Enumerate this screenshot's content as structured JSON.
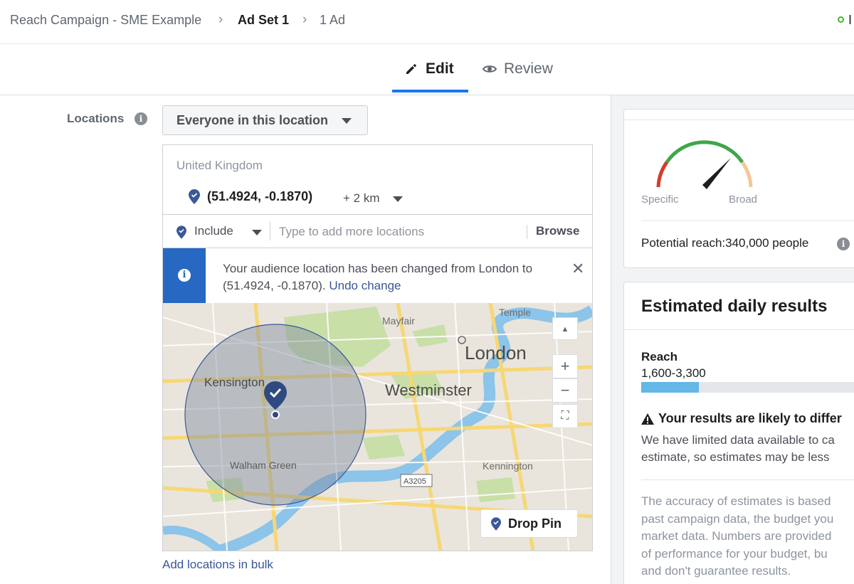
{
  "breadcrumb": {
    "campaign": "Reach Campaign - SME Example",
    "ad_set": "Ad Set 1",
    "ad": "1 Ad",
    "status_initial": "I"
  },
  "tabs": {
    "edit": "Edit",
    "review": "Review"
  },
  "locations": {
    "label": "Locations",
    "audience_type": "Everyone in this location",
    "country": "United Kingdom",
    "pin_coords": "(51.4924, -0.1870)",
    "radius": "+ 2 km",
    "include_label": "Include",
    "search_placeholder": "Type to add more locations",
    "search_value": "",
    "browse_label": "Browse",
    "notice_text": "Your audience location has been changed from London to (51.4924, -0.1870).",
    "undo_label": "Undo change",
    "bulk_link": "Add locations in bulk"
  },
  "map": {
    "places": [
      "Mayfair",
      "Temple",
      "London",
      "Kensington",
      "Westminster",
      "Walham Green",
      "Kennington",
      "A3205"
    ],
    "zoom_in": "+",
    "zoom_out": "−",
    "drop_pin_label": "Drop Pin"
  },
  "audience_size": {
    "label_specific": "Specific",
    "label_broad": "Broad",
    "potential_reach": "Potential reach:340,000 people"
  },
  "estimated": {
    "title": "Estimated daily results",
    "reach_label": "Reach",
    "reach_range": "1,600-3,300",
    "reach_bar_fraction": 0.27,
    "warning_title": "Your results are likely to differ",
    "warning_line1": "We have limited data available to ca",
    "warning_line2": "estimate, so estimates may be less",
    "accuracy_lines": [
      "The accuracy of estimates is based",
      "past campaign data, the budget you",
      "market data. Numbers are provided",
      "of performance for your budget, bu",
      "and don't guarantee results."
    ]
  },
  "colors": {
    "accent": "#1877f2",
    "link": "#385898",
    "notice": "#2768c3",
    "status_green": "#42b72a",
    "reach_bar": "#64b7e6"
  }
}
